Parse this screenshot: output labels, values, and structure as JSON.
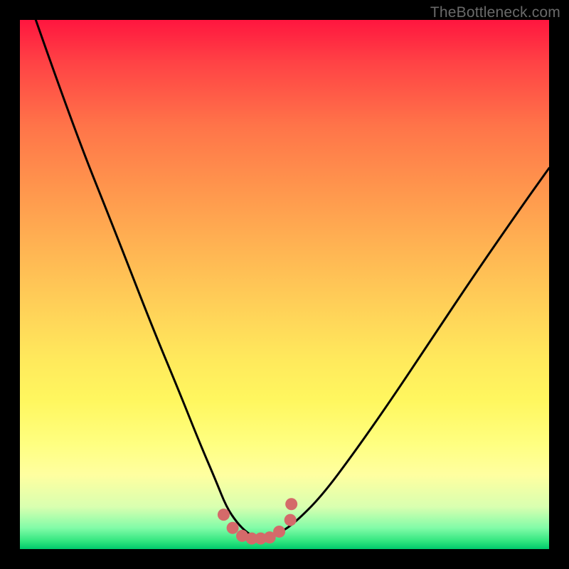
{
  "watermark": "TheBottleneck.com",
  "chart_data": {
    "type": "line",
    "title": "",
    "xlabel": "",
    "ylabel": "",
    "xlim": [
      0,
      100
    ],
    "ylim": [
      0,
      100
    ],
    "series": [
      {
        "name": "bottleneck-curve",
        "x": [
          3,
          10,
          18,
          25,
          30,
          34,
          37,
          39,
          41,
          43,
          45,
          47,
          49,
          52,
          57,
          63,
          70,
          78,
          86,
          95,
          100
        ],
        "y": [
          100,
          80,
          60,
          42,
          30,
          20,
          13,
          8,
          5,
          3,
          2,
          2,
          3,
          5,
          10,
          18,
          28,
          40,
          52,
          65,
          72
        ]
      }
    ],
    "markers": {
      "name": "trough-points",
      "color": "#d46a6a",
      "x": [
        38.5,
        40.2,
        42.0,
        43.8,
        45.5,
        47.2,
        49.0,
        51.1,
        51.3
      ],
      "y": [
        6.5,
        4.0,
        2.5,
        2.0,
        2.0,
        2.2,
        3.3,
        5.5,
        8.5
      ]
    }
  }
}
